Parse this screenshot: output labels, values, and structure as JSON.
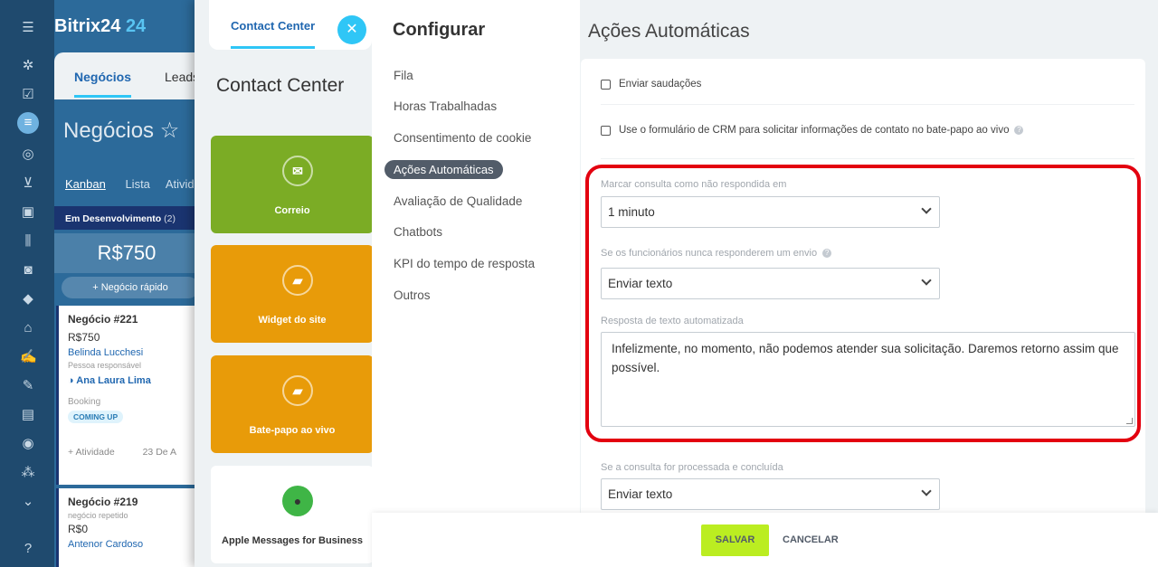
{
  "rail": {
    "icons": [
      "menu-icon",
      "pulse-icon",
      "tasks-icon",
      "crm-icon",
      "target-icon",
      "cart-icon",
      "contact-icon",
      "analytics-icon",
      "robot-icon",
      "box-icon",
      "bank-icon",
      "sign-icon",
      "docs-icon",
      "calendar-icon",
      "circle-icon",
      "apps-icon",
      "chevron-icon",
      "help-icon"
    ]
  },
  "bitrix": {
    "logo_text": "Bitrix24",
    "logo_num": "24",
    "tab_deals": "Negócios",
    "tab_leads": "Leads",
    "title": "Negócios",
    "view_kanban": "Kanban",
    "view_list": "Lista",
    "view_activity": "Ativid",
    "stage_name": "Em Desenvolvimento",
    "stage_count": "(2)",
    "stage_sum": "R$750",
    "quick_deal": "+ Negócio rápido",
    "card1": {
      "title": "Negócio #221",
      "amount": "R$750",
      "contact": "Belinda Lucchesi",
      "resp_label": "Pessoa responsável",
      "resp_name": "Ana Laura Lima",
      "booking": "Booking",
      "badge": "COMING UP",
      "activity": "+ Atividade",
      "date": "23 De A"
    },
    "card2": {
      "title": "Negócio #219",
      "repeat": "negócio repetido",
      "amount": "R$0",
      "contact": "Antenor Cardoso"
    }
  },
  "contact_center": {
    "tab": "Contact Center",
    "title": "Contact Center",
    "tiles": [
      "Correio",
      "Widget do site",
      "Bate-papo ao vivo",
      "Apple Messages for Business"
    ]
  },
  "configure": {
    "heading": "Configurar",
    "nav": [
      "Fila",
      "Horas Trabalhadas",
      "Consentimento de cookie",
      "Ações Automáticas",
      "Avaliação de Qualidade",
      "Chatbots",
      "KPI do tempo de resposta",
      "Outros"
    ],
    "section_title": "Ações Automáticas",
    "checkbox_greetings": "Enviar saudações",
    "checkbox_crm_form": "Use o formulário de CRM para solicitar informações de contato no bate-papo ao vivo",
    "label_unanswered": "Marcar consulta como não respondida em",
    "value_unanswered": "1 minuto",
    "label_no_response": "Se os funcionários nunca responderem um envio",
    "value_no_response": "Enviar texto",
    "label_auto_text": "Resposta de texto automatizada",
    "value_auto_text": "Infelizmente, no momento, não podemos atender sua solicitação. Daremos retorno assim que possível.",
    "label_closed": "Se a consulta for processada e concluída",
    "value_closed": "Enviar texto",
    "save": "SALVAR",
    "cancel": "CANCELAR",
    "highlight_color": "#e3000f"
  }
}
